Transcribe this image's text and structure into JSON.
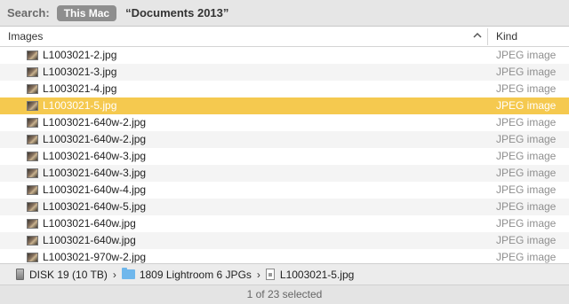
{
  "search": {
    "label": "Search:",
    "scope_selected": "This Mac",
    "scope_folder": "“Documents 2013”"
  },
  "columns": {
    "name": "Images",
    "kind": "Kind",
    "sort": "ascending"
  },
  "files": [
    {
      "name": "L1003021-2.jpg",
      "kind": "JPEG image"
    },
    {
      "name": "L1003021-3.jpg",
      "kind": "JPEG image"
    },
    {
      "name": "L1003021-4.jpg",
      "kind": "JPEG image"
    },
    {
      "name": "L1003021-5.jpg",
      "kind": "JPEG image",
      "selected": true
    },
    {
      "name": "L1003021-640w-2.jpg",
      "kind": "JPEG image"
    },
    {
      "name": "L1003021-640w-2.jpg",
      "kind": "JPEG image"
    },
    {
      "name": "L1003021-640w-3.jpg",
      "kind": "JPEG image"
    },
    {
      "name": "L1003021-640w-3.jpg",
      "kind": "JPEG image"
    },
    {
      "name": "L1003021-640w-4.jpg",
      "kind": "JPEG image"
    },
    {
      "name": "L1003021-640w-5.jpg",
      "kind": "JPEG image"
    },
    {
      "name": "L1003021-640w.jpg",
      "kind": "JPEG image"
    },
    {
      "name": "L1003021-640w.jpg",
      "kind": "JPEG image"
    },
    {
      "name": "L1003021-970w-2.jpg",
      "kind": "JPEG image"
    }
  ],
  "path": {
    "disk": "DISK 19 (10 TB)",
    "folder": "1809 Lightroom 6 JPGs",
    "file": "L1003021-5.jpg",
    "separator": "›"
  },
  "status": "1 of 23 selected",
  "colors": {
    "selection": "#f5c94f",
    "scope_button": "#8e8e8e",
    "folder_icon": "#6fb7ec"
  },
  "icons": {
    "thumbnail": "jpeg-thumbnail-icon",
    "disk": "hard-disk-icon",
    "folder": "folder-icon",
    "file": "document-icon",
    "sort": "sort-ascending-icon"
  }
}
